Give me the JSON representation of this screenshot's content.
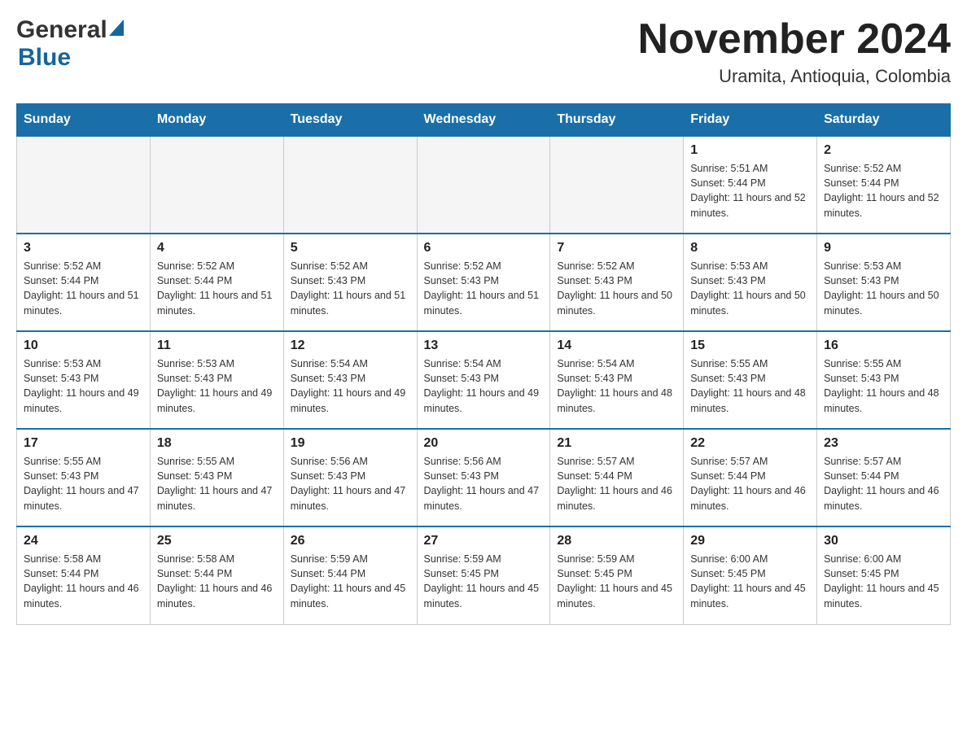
{
  "logo": {
    "general": "General",
    "blue": "Blue"
  },
  "header": {
    "month_year": "November 2024",
    "location": "Uramita, Antioquia, Colombia"
  },
  "weekdays": [
    "Sunday",
    "Monday",
    "Tuesday",
    "Wednesday",
    "Thursday",
    "Friday",
    "Saturday"
  ],
  "weeks": [
    [
      {
        "day": "",
        "info": "",
        "empty": true
      },
      {
        "day": "",
        "info": "",
        "empty": true
      },
      {
        "day": "",
        "info": "",
        "empty": true
      },
      {
        "day": "",
        "info": "",
        "empty": true
      },
      {
        "day": "",
        "info": "",
        "empty": true
      },
      {
        "day": "1",
        "info": "Sunrise: 5:51 AM\nSunset: 5:44 PM\nDaylight: 11 hours and 52 minutes."
      },
      {
        "day": "2",
        "info": "Sunrise: 5:52 AM\nSunset: 5:44 PM\nDaylight: 11 hours and 52 minutes."
      }
    ],
    [
      {
        "day": "3",
        "info": "Sunrise: 5:52 AM\nSunset: 5:44 PM\nDaylight: 11 hours and 51 minutes."
      },
      {
        "day": "4",
        "info": "Sunrise: 5:52 AM\nSunset: 5:44 PM\nDaylight: 11 hours and 51 minutes."
      },
      {
        "day": "5",
        "info": "Sunrise: 5:52 AM\nSunset: 5:43 PM\nDaylight: 11 hours and 51 minutes."
      },
      {
        "day": "6",
        "info": "Sunrise: 5:52 AM\nSunset: 5:43 PM\nDaylight: 11 hours and 51 minutes."
      },
      {
        "day": "7",
        "info": "Sunrise: 5:52 AM\nSunset: 5:43 PM\nDaylight: 11 hours and 50 minutes."
      },
      {
        "day": "8",
        "info": "Sunrise: 5:53 AM\nSunset: 5:43 PM\nDaylight: 11 hours and 50 minutes."
      },
      {
        "day": "9",
        "info": "Sunrise: 5:53 AM\nSunset: 5:43 PM\nDaylight: 11 hours and 50 minutes."
      }
    ],
    [
      {
        "day": "10",
        "info": "Sunrise: 5:53 AM\nSunset: 5:43 PM\nDaylight: 11 hours and 49 minutes."
      },
      {
        "day": "11",
        "info": "Sunrise: 5:53 AM\nSunset: 5:43 PM\nDaylight: 11 hours and 49 minutes."
      },
      {
        "day": "12",
        "info": "Sunrise: 5:54 AM\nSunset: 5:43 PM\nDaylight: 11 hours and 49 minutes."
      },
      {
        "day": "13",
        "info": "Sunrise: 5:54 AM\nSunset: 5:43 PM\nDaylight: 11 hours and 49 minutes."
      },
      {
        "day": "14",
        "info": "Sunrise: 5:54 AM\nSunset: 5:43 PM\nDaylight: 11 hours and 48 minutes."
      },
      {
        "day": "15",
        "info": "Sunrise: 5:55 AM\nSunset: 5:43 PM\nDaylight: 11 hours and 48 minutes."
      },
      {
        "day": "16",
        "info": "Sunrise: 5:55 AM\nSunset: 5:43 PM\nDaylight: 11 hours and 48 minutes."
      }
    ],
    [
      {
        "day": "17",
        "info": "Sunrise: 5:55 AM\nSunset: 5:43 PM\nDaylight: 11 hours and 47 minutes."
      },
      {
        "day": "18",
        "info": "Sunrise: 5:55 AM\nSunset: 5:43 PM\nDaylight: 11 hours and 47 minutes."
      },
      {
        "day": "19",
        "info": "Sunrise: 5:56 AM\nSunset: 5:43 PM\nDaylight: 11 hours and 47 minutes."
      },
      {
        "day": "20",
        "info": "Sunrise: 5:56 AM\nSunset: 5:43 PM\nDaylight: 11 hours and 47 minutes."
      },
      {
        "day": "21",
        "info": "Sunrise: 5:57 AM\nSunset: 5:44 PM\nDaylight: 11 hours and 46 minutes."
      },
      {
        "day": "22",
        "info": "Sunrise: 5:57 AM\nSunset: 5:44 PM\nDaylight: 11 hours and 46 minutes."
      },
      {
        "day": "23",
        "info": "Sunrise: 5:57 AM\nSunset: 5:44 PM\nDaylight: 11 hours and 46 minutes."
      }
    ],
    [
      {
        "day": "24",
        "info": "Sunrise: 5:58 AM\nSunset: 5:44 PM\nDaylight: 11 hours and 46 minutes."
      },
      {
        "day": "25",
        "info": "Sunrise: 5:58 AM\nSunset: 5:44 PM\nDaylight: 11 hours and 46 minutes."
      },
      {
        "day": "26",
        "info": "Sunrise: 5:59 AM\nSunset: 5:44 PM\nDaylight: 11 hours and 45 minutes."
      },
      {
        "day": "27",
        "info": "Sunrise: 5:59 AM\nSunset: 5:45 PM\nDaylight: 11 hours and 45 minutes."
      },
      {
        "day": "28",
        "info": "Sunrise: 5:59 AM\nSunset: 5:45 PM\nDaylight: 11 hours and 45 minutes."
      },
      {
        "day": "29",
        "info": "Sunrise: 6:00 AM\nSunset: 5:45 PM\nDaylight: 11 hours and 45 minutes."
      },
      {
        "day": "30",
        "info": "Sunrise: 6:00 AM\nSunset: 5:45 PM\nDaylight: 11 hours and 45 minutes."
      }
    ]
  ]
}
